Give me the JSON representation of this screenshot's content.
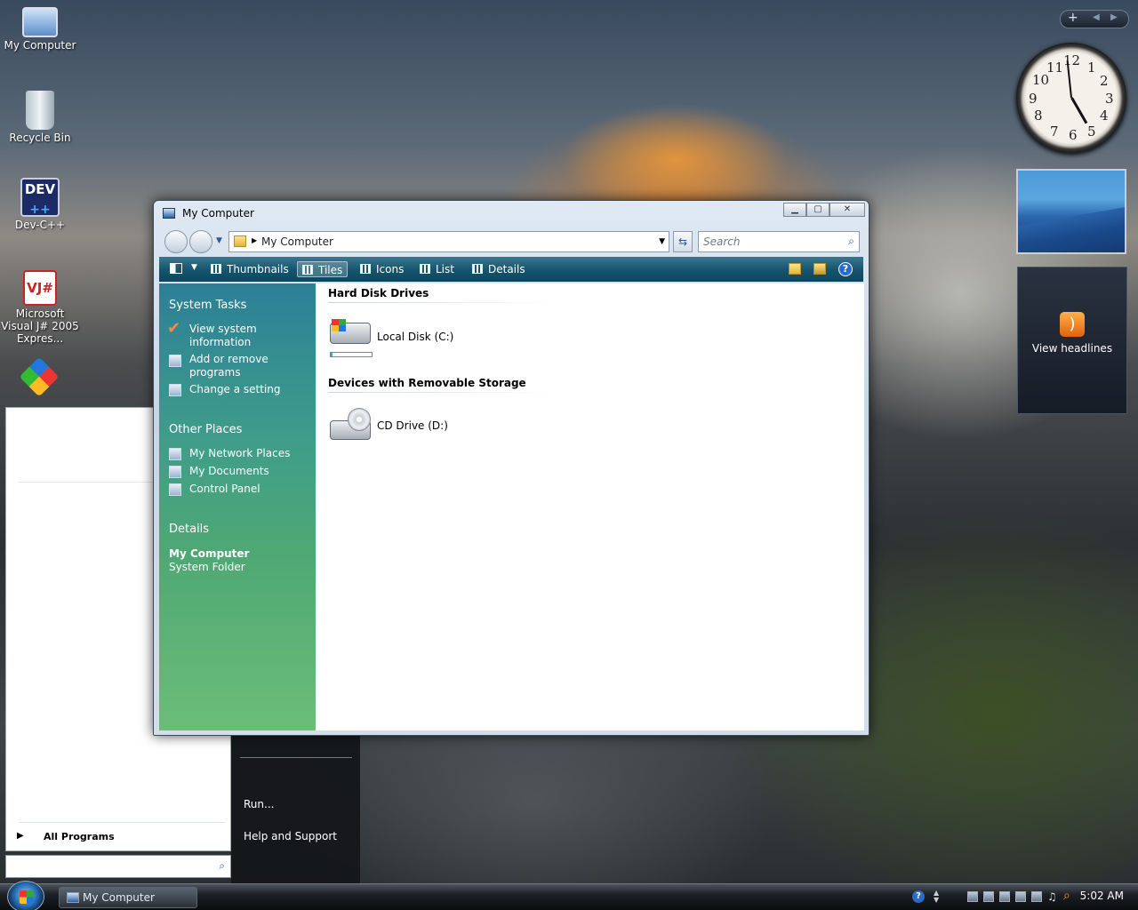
{
  "desktop": {
    "icons": [
      {
        "label": "My Computer"
      },
      {
        "label": "Recycle Bin"
      },
      {
        "label": "Dev-C++"
      },
      {
        "label": "Microsoft Visual J# 2005 Expres..."
      }
    ],
    "dev_icon_text": "DEV",
    "dev_icon_plus": "++",
    "vj_icon_text": "VJ#"
  },
  "sidebar": {
    "add_label": "+",
    "clock_numbers": [
      "12",
      "1",
      "2",
      "3",
      "4",
      "5",
      "6",
      "7",
      "8",
      "9",
      "10",
      "11"
    ],
    "feed": {
      "label": "View headlines"
    }
  },
  "start_menu": {
    "all_programs": "All Programs",
    "right_items": [
      "Run...",
      "Help and Support"
    ]
  },
  "window": {
    "title": "My Computer",
    "address": {
      "location": "My Computer"
    },
    "search": {
      "placeholder": "Search"
    },
    "toolbar": {
      "items": [
        "Thumbnails",
        "Tiles",
        "Icons",
        "List",
        "Details"
      ],
      "active": "Tiles"
    },
    "task_pane": {
      "system_tasks": {
        "header": "System Tasks",
        "items": [
          "View system information",
          "Add or remove programs",
          "Change a setting"
        ]
      },
      "other_places": {
        "header": "Other Places",
        "items": [
          "My Network Places",
          "My Documents",
          "Control Panel"
        ]
      },
      "details": {
        "header": "Details",
        "name": "My Computer",
        "type": "System Folder"
      }
    },
    "content": {
      "groups": [
        {
          "title": "Hard Disk Drives",
          "items": [
            {
              "label": "Local Disk (C:)"
            }
          ]
        },
        {
          "title": "Devices with Removable Storage",
          "items": [
            {
              "label": "CD Drive (D:)"
            }
          ]
        }
      ]
    }
  },
  "taskbar": {
    "task": "My Computer",
    "time": "5:02 AM"
  }
}
